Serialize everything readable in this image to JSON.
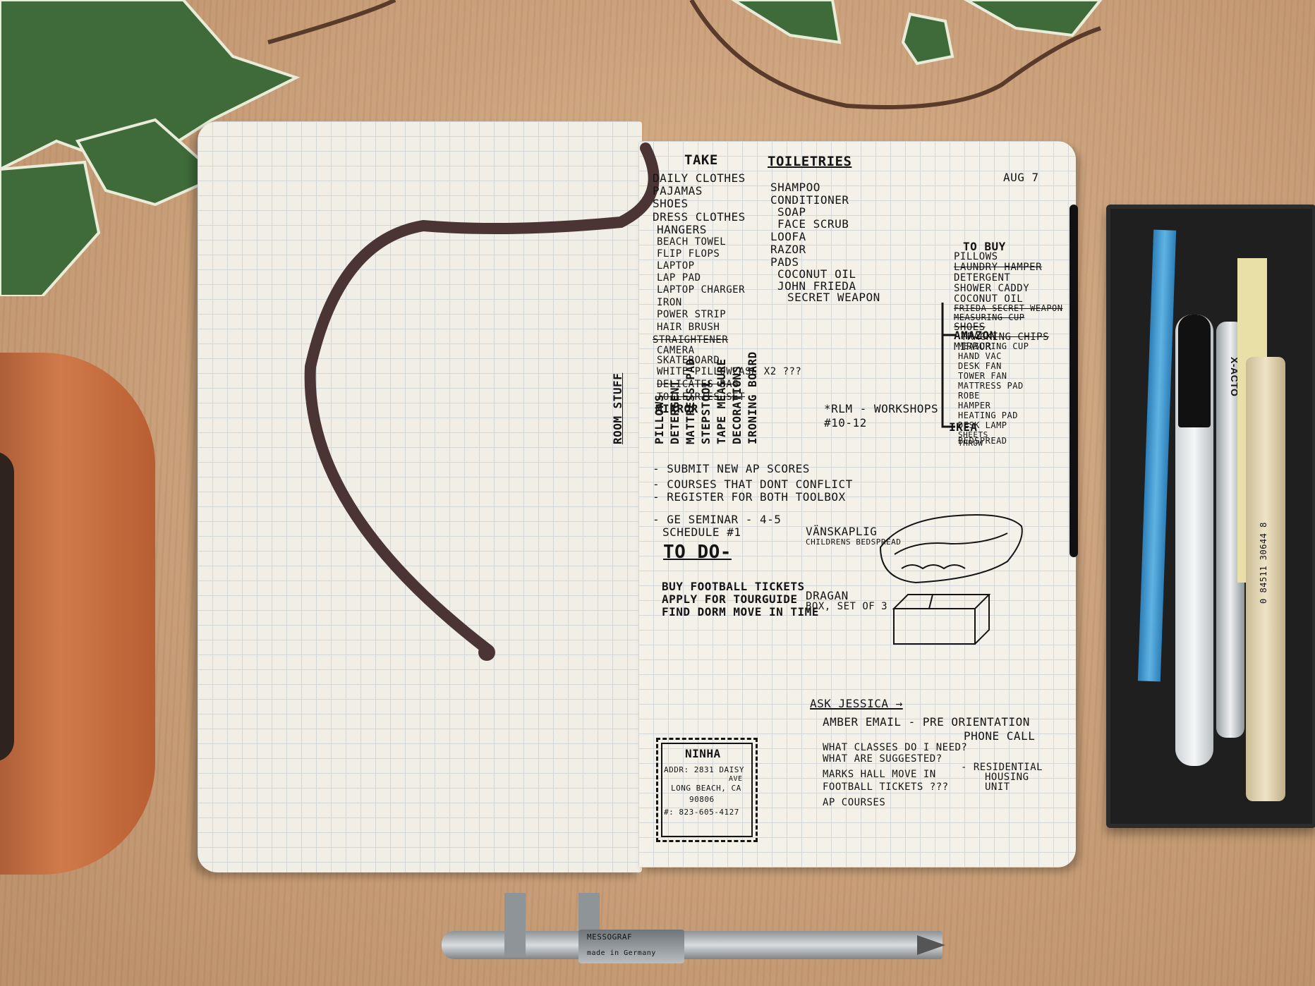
{
  "photo": {
    "colors": {
      "desk": "#caa07a",
      "paper": "#f3efe4",
      "grid": "#cfd4d8",
      "ink": "#141414",
      "ribbon": "#4a3534",
      "pot": "#c0693f",
      "tray": "#222222"
    },
    "icons": [
      "ivy-leaves-icon",
      "flower-pot-icon",
      "ribbon-bookmark-icon",
      "pen-tray-icon",
      "caliper-pen-icon"
    ]
  },
  "notebook": {
    "date": "AUG 7",
    "take": {
      "title": "TAKE",
      "items": [
        "DAILY CLOTHES",
        "PAJAMAS",
        "SHOES",
        "DRESS CLOTHES",
        "HANGERS",
        "BEACH TOWEL",
        "FLIP FLOPS",
        "LAPTOP",
        "LAP PAD",
        "LAPTOP CHARGER",
        "IRON",
        "POWER STRIP",
        "HAIR BRUSH",
        "STRAIGHTENER",
        "CAMERA",
        "SKATEBOARD",
        "WHITE PILLOWCASE x2 ???",
        "DELICATES BAG",
        "TOILETRIES SET",
        "MIRROR"
      ]
    },
    "room_stuff": {
      "title": "ROOM STUFF",
      "items": [
        "PILLOWS",
        "DETERGENT",
        "MATTRESS PAD",
        "STEPSTOOL",
        "TAPE MEASURE",
        "DECORATIONS",
        "IRONING BOARD"
      ]
    },
    "toiletries": {
      "title": "TOILETRIES",
      "items": [
        "SHAMPOO",
        "CONDITIONER",
        "SOAP",
        "FACE SCRUB",
        "LOOFA",
        "RAZOR",
        "PADS",
        "COCONUT OIL",
        "JOHN FRIEDA",
        "SECRET WEAPON"
      ]
    },
    "to_buy": {
      "title": "TO BUY",
      "items": [
        "PILLOWS",
        "LAUNDRY HAMPER",
        "DETERGENT",
        "SHOWER CADDY",
        "COCONUT OIL",
        "FRIEDA SECRET WEAPON",
        "MEASURING CUP",
        "SHOES",
        "TRACKING CHIPS",
        "MIRROR"
      ],
      "amazon_title": "AMAZON",
      "amazon_items": [
        "MEASURING CUP",
        "HAND VAC",
        "DESK FAN",
        "TOWER FAN",
        "MATTRESS PAD",
        "ROBE",
        "HAMPER",
        "HEATING PAD",
        "DESK LAMP",
        "SHEETS",
        "THROW"
      ],
      "ikea_title": "IKEA",
      "ikea_items": [
        "BEDSPREAD"
      ]
    },
    "rlm": [
      "*RLM - WORKSHOPS",
      "#10-12"
    ],
    "tasks": [
      "- SUBMIT NEW AP SCORES",
      "- COURSES THAT DONT CONFLICT",
      "- REGISTER FOR BOTH TOOLBOX",
      "- GE SEMINAR - 4-5",
      "  SCHEDULE #1"
    ],
    "todo": {
      "title": "TO DO-",
      "items": [
        "BUY FOOTBALL TICKETS",
        "APPLY FOR TOURGUIDE",
        "FIND DORM MOVE IN TIME"
      ]
    },
    "sketches": [
      {
        "label": "VÄNSKAPLIG",
        "sub": "CHILDRENS BEDSPREAD"
      },
      {
        "label": "DRAGAN",
        "sub": "BOX, SET OF 3"
      }
    ],
    "ask": {
      "title": "ASK JESSICA →",
      "items": [
        "AMBER EMAIL - PRE ORIENTATION",
        "PHONE CALL",
        "WHAT CLASSES DO I NEED?",
        "WHAT ARE SUGGESTED?",
        "MARKS HALL MOVE IN",
        "FOOTBALL TICKETS ???",
        "AP COURSES",
        "- RESIDENTIAL",
        "HOUSING",
        "UNIT"
      ]
    },
    "stamp": {
      "title": "NINHA",
      "lines": [
        "ADDR: 2831 DAISY",
        "AVE",
        "LONG BEACH, CA",
        "90806",
        "#: 823-605-4127"
      ]
    }
  },
  "objects": {
    "tray_labels": [
      "X-ACTO",
      "0 84511 30644 8"
    ],
    "caliper_labels": [
      "MESSOGRAF",
      "made in Germany"
    ]
  }
}
